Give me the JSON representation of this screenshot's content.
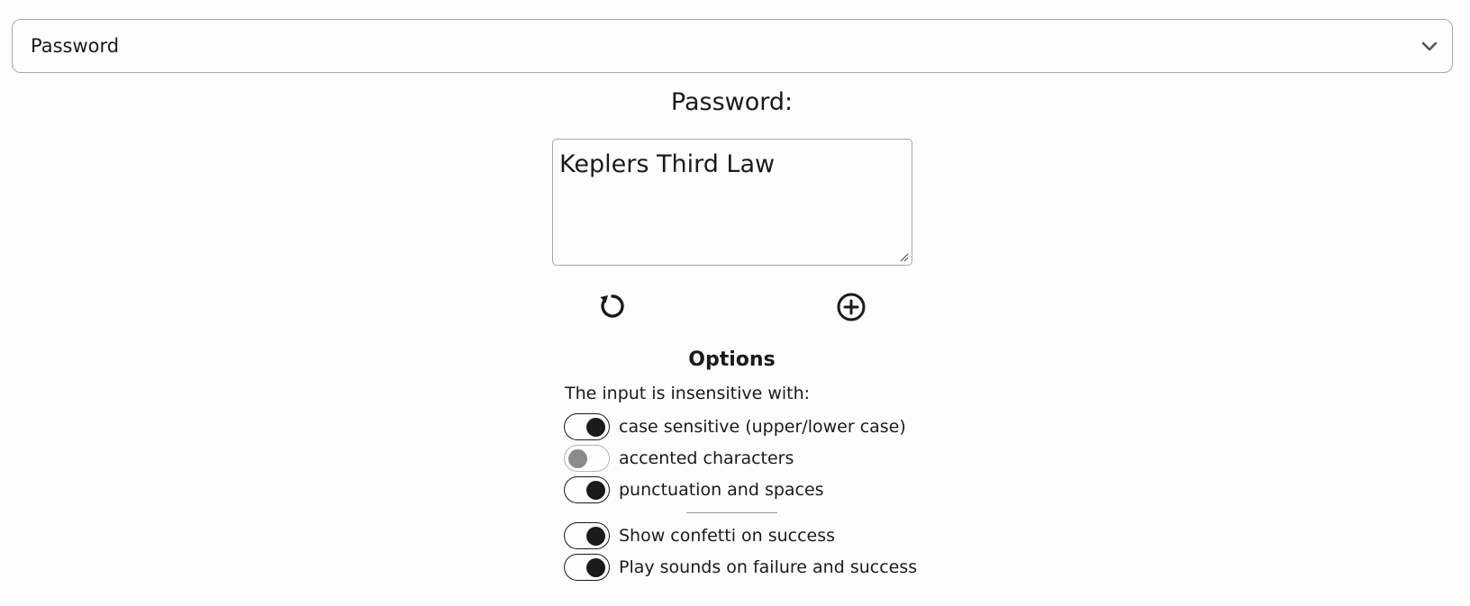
{
  "select": {
    "value": "Password",
    "icon": "chevron-down-icon"
  },
  "password": {
    "label": "Password:",
    "value": "Keplers Third Law"
  },
  "actions": {
    "reset_icon": "reset-icon",
    "add_icon": "add-circle-icon"
  },
  "options": {
    "title": "Options",
    "subtitle": "The input is insensitive with:",
    "toggles": [
      {
        "label": "case sensitive (upper/lower case)",
        "on": true
      },
      {
        "label": "accented characters",
        "on": false
      },
      {
        "label": "punctuation and spaces",
        "on": true
      },
      {
        "label": "Show confetti on success",
        "on": true
      },
      {
        "label": "Play sounds on failure and success",
        "on": true
      }
    ]
  },
  "colors": {
    "text": "#1a1a1a",
    "border": "#a8a8a8",
    "toggle_off": "#8a8a8a",
    "background": "#fdfdfd"
  }
}
